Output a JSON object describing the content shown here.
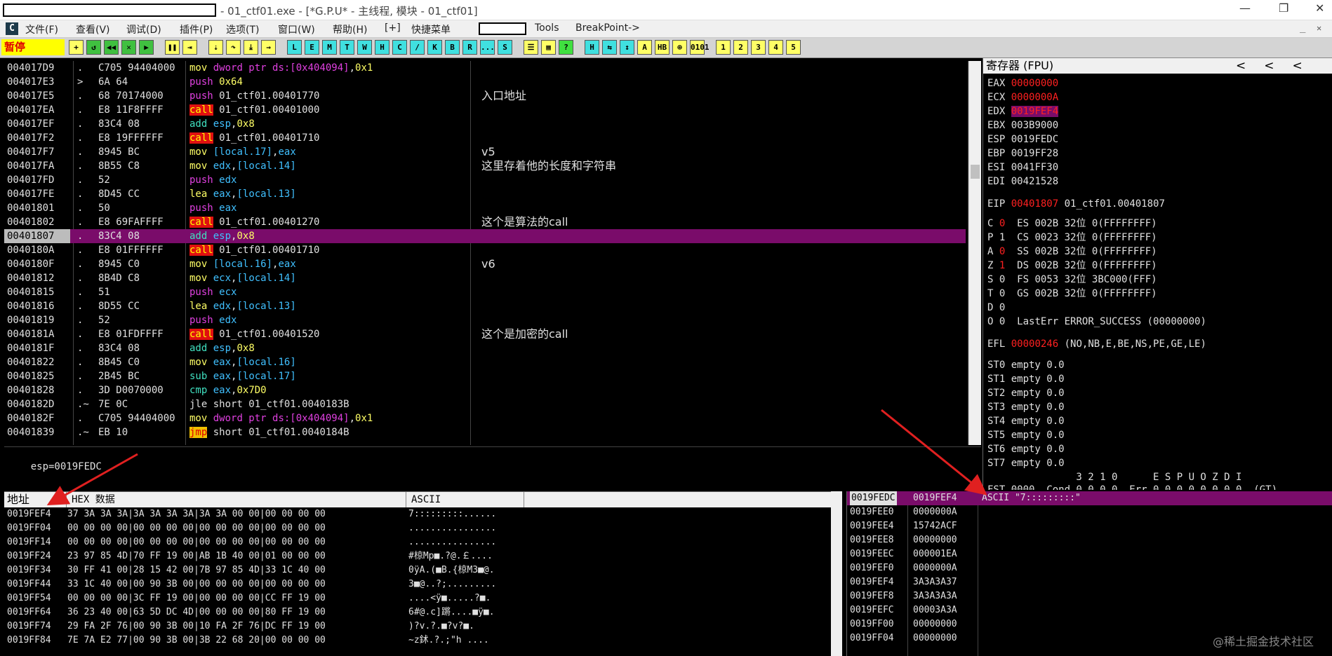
{
  "titlebar": {
    "title": "- 01_ctf01.exe - [*G.P.U* - 主线程, 模块 - 01_ctf01]",
    "minimize": "—",
    "restore": "❐",
    "close": "✕"
  },
  "menu": {
    "items": [
      "文件(F)",
      "查看(V)",
      "调试(D)",
      "插件(P)",
      "选项(T)",
      "窗口(W)",
      "帮助(H)",
      "[+]",
      "快捷菜单"
    ],
    "tools": "Tools",
    "breakpoint": "BreakPoint->",
    "logo": "C",
    "inner_min": "_",
    "inner_restore": "❐",
    "inner_close": "✕"
  },
  "toolbar": {
    "status": "暂停",
    "buttons": [
      "+",
      "↺",
      "◀◀",
      "✕",
      "▶",
      "❚❚",
      "⇥",
      "⇣",
      "↷",
      "⤓",
      "→",
      "L",
      "E",
      "M",
      "T",
      "W",
      "H",
      "C",
      "/",
      "K",
      "B",
      "R",
      "...",
      "S",
      "☰",
      "▦",
      "?",
      "H",
      "⇆",
      "↕",
      "A",
      "HB",
      "⊕",
      "0101",
      "1",
      "2",
      "3",
      "4",
      "5"
    ]
  },
  "disasm": {
    "rows": [
      {
        "addr": "004017D9",
        "mark": ".",
        "bytes": "C705 94404000",
        "op": "mov",
        "args": [
          [
            "dword ptr ds:[0x404094]",
            "mem"
          ],
          [
            ",",
            ""
          ],
          [
            "0x1",
            "num"
          ]
        ],
        "cmt": ""
      },
      {
        "addr": "004017E3",
        "mark": ">",
        "bytes": "6A 64",
        "op": "push",
        "args": [
          [
            "0x64",
            "num"
          ]
        ],
        "cmt": ""
      },
      {
        "addr": "004017E5",
        "mark": ".",
        "bytes": "68 70174000",
        "op": "push",
        "args": [
          [
            "01_ctf01.00401770",
            ""
          ]
        ],
        "cmt": "入口地址"
      },
      {
        "addr": "004017EA",
        "mark": ".",
        "bytes": "E8 11F8FFFF",
        "op": "call",
        "args": [
          [
            "01_ctf01.00401000",
            ""
          ]
        ],
        "cmt": ""
      },
      {
        "addr": "004017EF",
        "mark": ".",
        "bytes": "83C4 08",
        "op": "add",
        "args": [
          [
            "esp",
            "reg"
          ],
          [
            ",",
            ""
          ],
          [
            "0x8",
            "num"
          ]
        ],
        "cmt": ""
      },
      {
        "addr": "004017F2",
        "mark": ".",
        "bytes": "E8 19FFFFFF",
        "op": "call",
        "args": [
          [
            "01_ctf01.00401710",
            ""
          ]
        ],
        "cmt": ""
      },
      {
        "addr": "004017F7",
        "mark": ".",
        "bytes": "8945 BC",
        "op": "mov",
        "args": [
          [
            "[local.17]",
            "reg"
          ],
          [
            ",",
            ""
          ],
          [
            "eax",
            "reg"
          ]
        ],
        "cmt": "v5"
      },
      {
        "addr": "004017FA",
        "mark": ".",
        "bytes": "8B55 C8",
        "op": "mov",
        "args": [
          [
            "edx",
            "reg"
          ],
          [
            ",",
            ""
          ],
          [
            "[local.14]",
            "reg"
          ]
        ],
        "cmt": "这里存着他的长度和字符串"
      },
      {
        "addr": "004017FD",
        "mark": ".",
        "bytes": "52",
        "op": "push",
        "args": [
          [
            "edx",
            "reg"
          ]
        ],
        "cmt": ""
      },
      {
        "addr": "004017FE",
        "mark": ".",
        "bytes": "8D45 CC",
        "op": "lea",
        "args": [
          [
            "eax",
            "reg"
          ],
          [
            ",",
            ""
          ],
          [
            "[local.13]",
            "reg"
          ]
        ],
        "cmt": ""
      },
      {
        "addr": "00401801",
        "mark": ".",
        "bytes": "50",
        "op": "push",
        "args": [
          [
            "eax",
            "reg"
          ]
        ],
        "cmt": ""
      },
      {
        "addr": "00401802",
        "mark": ".",
        "bytes": "E8 69FAFFFF",
        "op": "call",
        "args": [
          [
            "01_ctf01.00401270",
            ""
          ]
        ],
        "cmt": "这个是算法的call"
      },
      {
        "addr": "00401807",
        "mark": ".",
        "bytes": "83C4 08",
        "op": "add",
        "args": [
          [
            "esp",
            "reg"
          ],
          [
            ",",
            ""
          ],
          [
            "0x8",
            "num"
          ]
        ],
        "cmt": "",
        "sel": true
      },
      {
        "addr": "0040180A",
        "mark": ".",
        "bytes": "E8 01FFFFFF",
        "op": "call",
        "args": [
          [
            "01_ctf01.00401710",
            ""
          ]
        ],
        "cmt": ""
      },
      {
        "addr": "0040180F",
        "mark": ".",
        "bytes": "8945 C0",
        "op": "mov",
        "args": [
          [
            "[local.16]",
            "reg"
          ],
          [
            ",",
            ""
          ],
          [
            "eax",
            "reg"
          ]
        ],
        "cmt": "v6"
      },
      {
        "addr": "00401812",
        "mark": ".",
        "bytes": "8B4D C8",
        "op": "mov",
        "args": [
          [
            "ecx",
            "reg"
          ],
          [
            ",",
            ""
          ],
          [
            "[local.14]",
            "reg"
          ]
        ],
        "cmt": ""
      },
      {
        "addr": "00401815",
        "mark": ".",
        "bytes": "51",
        "op": "push",
        "args": [
          [
            "ecx",
            "reg"
          ]
        ],
        "cmt": ""
      },
      {
        "addr": "00401816",
        "mark": ".",
        "bytes": "8D55 CC",
        "op": "lea",
        "args": [
          [
            "edx",
            "reg"
          ],
          [
            ",",
            ""
          ],
          [
            "[local.13]",
            "reg"
          ]
        ],
        "cmt": ""
      },
      {
        "addr": "00401819",
        "mark": ".",
        "bytes": "52",
        "op": "push",
        "args": [
          [
            "edx",
            "reg"
          ]
        ],
        "cmt": ""
      },
      {
        "addr": "0040181A",
        "mark": ".",
        "bytes": "E8 01FDFFFF",
        "op": "call",
        "args": [
          [
            "01_ctf01.00401520",
            ""
          ]
        ],
        "cmt": "这个是加密的call"
      },
      {
        "addr": "0040181F",
        "mark": ".",
        "bytes": "83C4 08",
        "op": "add",
        "args": [
          [
            "esp",
            "reg"
          ],
          [
            ",",
            ""
          ],
          [
            "0x8",
            "num"
          ]
        ],
        "cmt": ""
      },
      {
        "addr": "00401822",
        "mark": ".",
        "bytes": "8B45 C0",
        "op": "mov",
        "args": [
          [
            "eax",
            "reg"
          ],
          [
            ",",
            ""
          ],
          [
            "[local.16]",
            "reg"
          ]
        ],
        "cmt": ""
      },
      {
        "addr": "00401825",
        "mark": ".",
        "bytes": "2B45 BC",
        "op": "sub",
        "args": [
          [
            "eax",
            "reg"
          ],
          [
            ",",
            ""
          ],
          [
            "[local.17]",
            "reg"
          ]
        ],
        "cmt": ""
      },
      {
        "addr": "00401828",
        "mark": ".",
        "bytes": "3D D0070000",
        "op": "cmp",
        "args": [
          [
            "eax",
            "reg"
          ],
          [
            ",",
            ""
          ],
          [
            "0x7D0",
            "num"
          ]
        ],
        "cmt": ""
      },
      {
        "addr": "0040182D",
        "mark": ".~",
        "bytes": "7E 0C",
        "op": "jle",
        "args": [
          [
            "short 01_ctf01.0040183B",
            ""
          ]
        ],
        "cmt": ""
      },
      {
        "addr": "0040182F",
        "mark": ".",
        "bytes": "C705 94404000",
        "op": "mov",
        "args": [
          [
            "dword ptr ds:[0x404094]",
            "mem"
          ],
          [
            ",",
            ""
          ],
          [
            "0x1",
            "num"
          ]
        ],
        "cmt": ""
      },
      {
        "addr": "00401839",
        "mark": ".~",
        "bytes": "EB 10",
        "op": "jmp",
        "args": [
          [
            "short 01_ctf01.0040184B",
            ""
          ]
        ],
        "cmt": ""
      }
    ]
  },
  "info": {
    "line": "esp=0019FEDC"
  },
  "registers": {
    "header": "寄存器 (FPU)",
    "arrows": [
      "<",
      "<",
      "<"
    ],
    "gp": [
      {
        "n": "EAX",
        "v": "00000000",
        "s": "red"
      },
      {
        "n": "ECX",
        "v": "0000000A",
        "s": "red"
      },
      {
        "n": "EDX",
        "v": "0019FEF4",
        "s": "hl"
      },
      {
        "n": "EBX",
        "v": "003B9000",
        "s": ""
      },
      {
        "n": "ESP",
        "v": "0019FEDC",
        "s": ""
      },
      {
        "n": "EBP",
        "v": "0019FF28",
        "s": ""
      },
      {
        "n": "ESI",
        "v": "0041FF30",
        "s": ""
      },
      {
        "n": "EDI",
        "v": "00421528",
        "s": ""
      }
    ],
    "eip": {
      "n": "EIP",
      "v": "00401807",
      "d": "01_ctf01.00401807"
    },
    "flags": [
      {
        "f": "C",
        "v": "0",
        "red": true,
        "seg": "ES 002B 32位 0(FFFFFFFF)"
      },
      {
        "f": "P",
        "v": "1",
        "red": false,
        "seg": "CS 0023 32位 0(FFFFFFFF)"
      },
      {
        "f": "A",
        "v": "0",
        "red": true,
        "seg": "SS 002B 32位 0(FFFFFFFF)"
      },
      {
        "f": "Z",
        "v": "1",
        "red": true,
        "seg": "DS 002B 32位 0(FFFFFFFF)"
      },
      {
        "f": "S",
        "v": "0",
        "red": false,
        "seg": "FS 0053 32位 3BC000(FFF)"
      },
      {
        "f": "T",
        "v": "0",
        "red": false,
        "seg": "GS 002B 32位 0(FFFFFFFF)"
      },
      {
        "f": "D",
        "v": "0",
        "red": false,
        "seg": ""
      },
      {
        "f": "O",
        "v": "0",
        "red": false,
        "seg": "LastErr ERROR_SUCCESS (00000000)"
      }
    ],
    "efl": {
      "n": "EFL",
      "v": "00000246",
      "d": "(NO,NB,E,BE,NS,PE,GE,LE)"
    },
    "st": [
      "ST0 empty 0.0",
      "ST1 empty 0.0",
      "ST2 empty 0.0",
      "ST3 empty 0.0",
      "ST4 empty 0.0",
      "ST5 empty 0.0",
      "ST6 empty 0.0",
      "ST7 empty 0.0"
    ],
    "fpu_hdr": "               3 2 1 0      E S P U O Z D I",
    "fst": "FST 0000  Cond 0 0 0 0  Err 0 0 0 0 0 0 0 0  (GT)"
  },
  "dump": {
    "col_addr": "地址",
    "col_hex": "HEX 数据",
    "col_ascii": "ASCII",
    "rows": [
      {
        "a": "0019FEF4",
        "h": "37 3A 3A 3A|3A 3A 3A 3A|3A 3A 00 00|00 00 00 00",
        "s": "7:::::::::......"
      },
      {
        "a": "0019FF04",
        "h": "00 00 00 00|00 00 00 00|00 00 00 00|00 00 00 00",
        "s": "................"
      },
      {
        "a": "0019FF14",
        "h": "00 00 00 00|00 00 00 00|00 00 00 00|00 00 00 00",
        "s": "................"
      },
      {
        "a": "0019FF24",
        "h": "23 97 85 4D|70 FF 19 00|AB 1B 40 00|01 00 00 00",
        "s": "#椋Mp■.?@.￡...."
      },
      {
        "a": "0019FF34",
        "h": "30 FF 41 00|28 15 42 00|7B 97 85 4D|33 1C 40 00",
        "s": "0ÿA.(■B.{椋M3■@."
      },
      {
        "a": "0019FF44",
        "h": "33 1C 40 00|00 90 3B 00|00 00 00 00|00 00 00 00",
        "s": "3■@..?;........."
      },
      {
        "a": "0019FF54",
        "h": "00 00 00 00|3C FF 19 00|00 00 00 00|CC FF 19 00",
        "s": "....<ÿ■.....?■."
      },
      {
        "a": "0019FF64",
        "h": "36 23 40 00|63 5D DC 4D|00 00 00 00|80 FF 19 00",
        "s": "6#@.c]蹡....■ÿ■."
      },
      {
        "a": "0019FF74",
        "h": "29 FA 2F 76|00 90 3B 00|10 FA 2F 76|DC FF 19 00",
        "s": ")?v.?.■?v?■."
      },
      {
        "a": "0019FF84",
        "h": "7E 7A E2 77|00 90 3B 00|3B 22 68 20|00 00 00 00",
        "s": "~z鉥.?.;\"h ...."
      }
    ]
  },
  "stack": {
    "rows": [
      {
        "a": "0019FEDC",
        "v": "0019FEF4",
        "c": "ASCII \"7:::::::::\""
      },
      {
        "a": "0019FEE0",
        "v": "0000000A",
        "c": ""
      },
      {
        "a": "0019FEE4",
        "v": "15742ACF",
        "c": ""
      },
      {
        "a": "0019FEE8",
        "v": "00000000",
        "c": ""
      },
      {
        "a": "0019FEEC",
        "v": "000001EA",
        "c": ""
      },
      {
        "a": "0019FEF0",
        "v": "0000000A",
        "c": ""
      },
      {
        "a": "0019FEF4",
        "v": "3A3A3A37",
        "c": ""
      },
      {
        "a": "0019FEF8",
        "v": "3A3A3A3A",
        "c": ""
      },
      {
        "a": "0019FEFC",
        "v": "00003A3A",
        "c": ""
      },
      {
        "a": "0019FF00",
        "v": "00000000",
        "c": ""
      },
      {
        "a": "0019FF04",
        "v": "00000000",
        "c": ""
      }
    ]
  },
  "watermark": "@稀土掘金技术社区",
  "colors": {
    "selection": "#7a0c6a",
    "paused_bg": "#ffff00",
    "register_changed": "#ff2020"
  }
}
